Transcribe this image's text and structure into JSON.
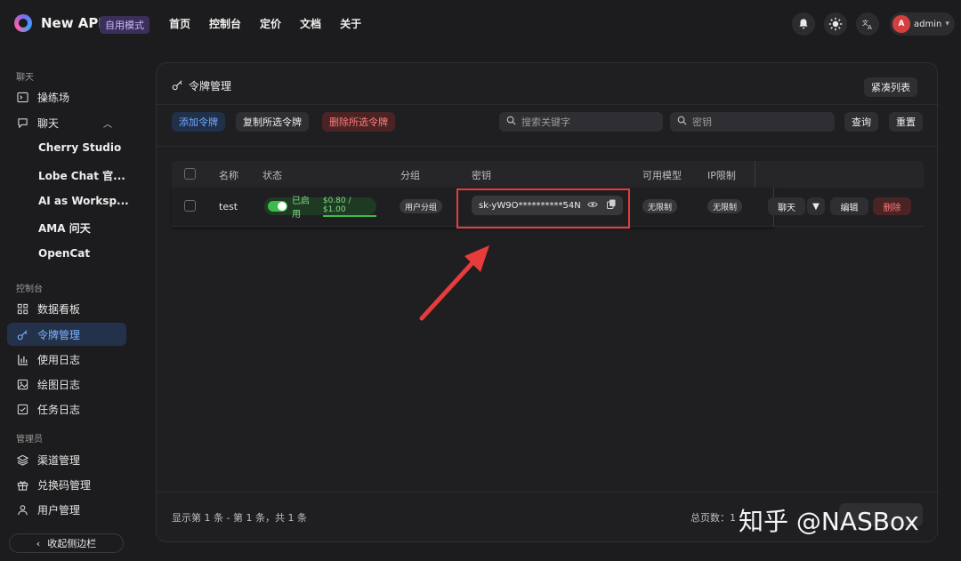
{
  "app": {
    "title": "New API",
    "mode_badge": "自用模式"
  },
  "topnav": [
    "首页",
    "控制台",
    "定价",
    "文档",
    "关于"
  ],
  "user": {
    "avatar_letter": "A",
    "name": "admin"
  },
  "sidebar": {
    "chat_section": "聊天",
    "playground": "操练场",
    "chat": "聊天",
    "chat_sub": [
      "Cherry Studio",
      "Lobe Chat 官...",
      "AI as Worksp...",
      "AMA 问天",
      "OpenCat"
    ],
    "console_section": "控制台",
    "console_items": [
      "数据看板",
      "令牌管理",
      "使用日志",
      "绘图日志",
      "任务日志"
    ],
    "admin_section": "管理员",
    "admin_items": [
      "渠道管理",
      "兑换码管理",
      "用户管理"
    ],
    "collapse": "收起侧边栏"
  },
  "panel": {
    "title": "令牌管理",
    "compact_list": "紧凑列表",
    "add_token": "添加令牌",
    "copy_selected": "复制所选令牌",
    "delete_selected": "删除所选令牌",
    "search_keyword_placeholder": "搜索关键字",
    "search_key_placeholder": "密钥",
    "query": "查询",
    "reset": "重置"
  },
  "table": {
    "headers": [
      "名称",
      "状态",
      "分组",
      "密钥",
      "可用模型",
      "IP限制"
    ],
    "rows": [
      {
        "name": "test",
        "status": "已启用",
        "quota": "$0.80 / $1.00",
        "group": "用户分组",
        "key": "sk-yW9O**********54N",
        "models": "无限制",
        "ip": "无限制",
        "chat": "聊天",
        "edit": "编辑",
        "delete": "删除"
      }
    ]
  },
  "footer": {
    "range": "显示第 1 条 - 第 1 条，共 1 条",
    "total_pages": "总页数：1"
  },
  "watermark": "知乎 @NASBox",
  "colors": {
    "accent_blue": "#6fa8ff",
    "danger": "#ff7a7a",
    "success": "#3dbb4a",
    "highlight_box": "#e83b3b"
  }
}
